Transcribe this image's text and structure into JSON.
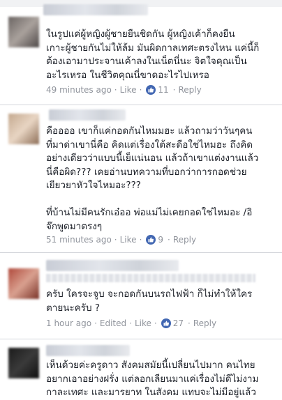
{
  "comments": [
    {
      "text": "ในรูปแค่ผู้หญิงผู้ชายยืนชิดกัน ผู้หญิงเค้าก็คงยืน\nเกาะผู้ชายกันไม่ให้ล้ม มันผิดกาลเทศะตรงไหน แค่นี้ก็\nต้องเอามาประจานเค้าลงในเน็ตนี่นะ จิตใจคุณเป็น\nอะไรเหรอ ในชีวิตคุณนี่ขาดอะไรไปเหรอ",
      "time": "49 minutes ago",
      "edited": "",
      "like_label": "Like",
      "likes": "11",
      "reply_label": "Reply"
    },
    {
      "text": "คืออออ เขาก็แค่กอดกันไหมมฮะ แล้วถามว่าวันๆคน\nที่มาด่าเขานี่คือ คิดแต่เรื่องใต้สะดือใช่ไหมฮะ ถึงคิด\nอย่างเดียวว่าแบบนี้เย็แน่นอน แล้วถ้าเขาแต่งงานแล้ว\nนี่คือผิด??? เคยอ่านบทความที่บอกว่าการกอดช่วย\nเยียวยาหัวใจไหมอะ???\n\nที่บ้านไม่มีคนรักเอ๋ออ พ่อแม่ไม่เคยกอดใช่ไหมอะ /อิ\nจ๊กพูดมาตรงๆ",
      "time": "51 minutes ago",
      "edited": "",
      "like_label": "Like",
      "likes": "9",
      "reply_label": "Reply"
    },
    {
      "text": "ครับ ใครจะจูบ จะกอดกันบนรถไฟฟ้า ก็ไม่ทำให้ใคร\nตายนะครับ ?",
      "time": "1 hour ago",
      "edited": "Edited",
      "like_label": "Like",
      "likes": "27",
      "reply_label": "Reply"
    },
    {
      "text": "เห็นด้วยค่ะครูดาว สังคมสมัยนี้เปลี่ยนไปมาก คนไทย\nอยากเอาอย่างฝรั่ง แต่ลอกเลียนมาแค่เรื่องไม่ดีไม่งาม\nกาละเทศะ และมารยาท ในสังคม แทบจะไม่มีอยู่แล้ว",
      "time": "",
      "edited": "",
      "like_label": "",
      "likes": "",
      "reply_label": ""
    }
  ],
  "colors": {
    "text": "#1d2129",
    "meta": "#90949c",
    "like_icon": "#4267b2",
    "divider": "#d3d6db"
  },
  "icons": {
    "like": "thumbs-up-icon"
  }
}
